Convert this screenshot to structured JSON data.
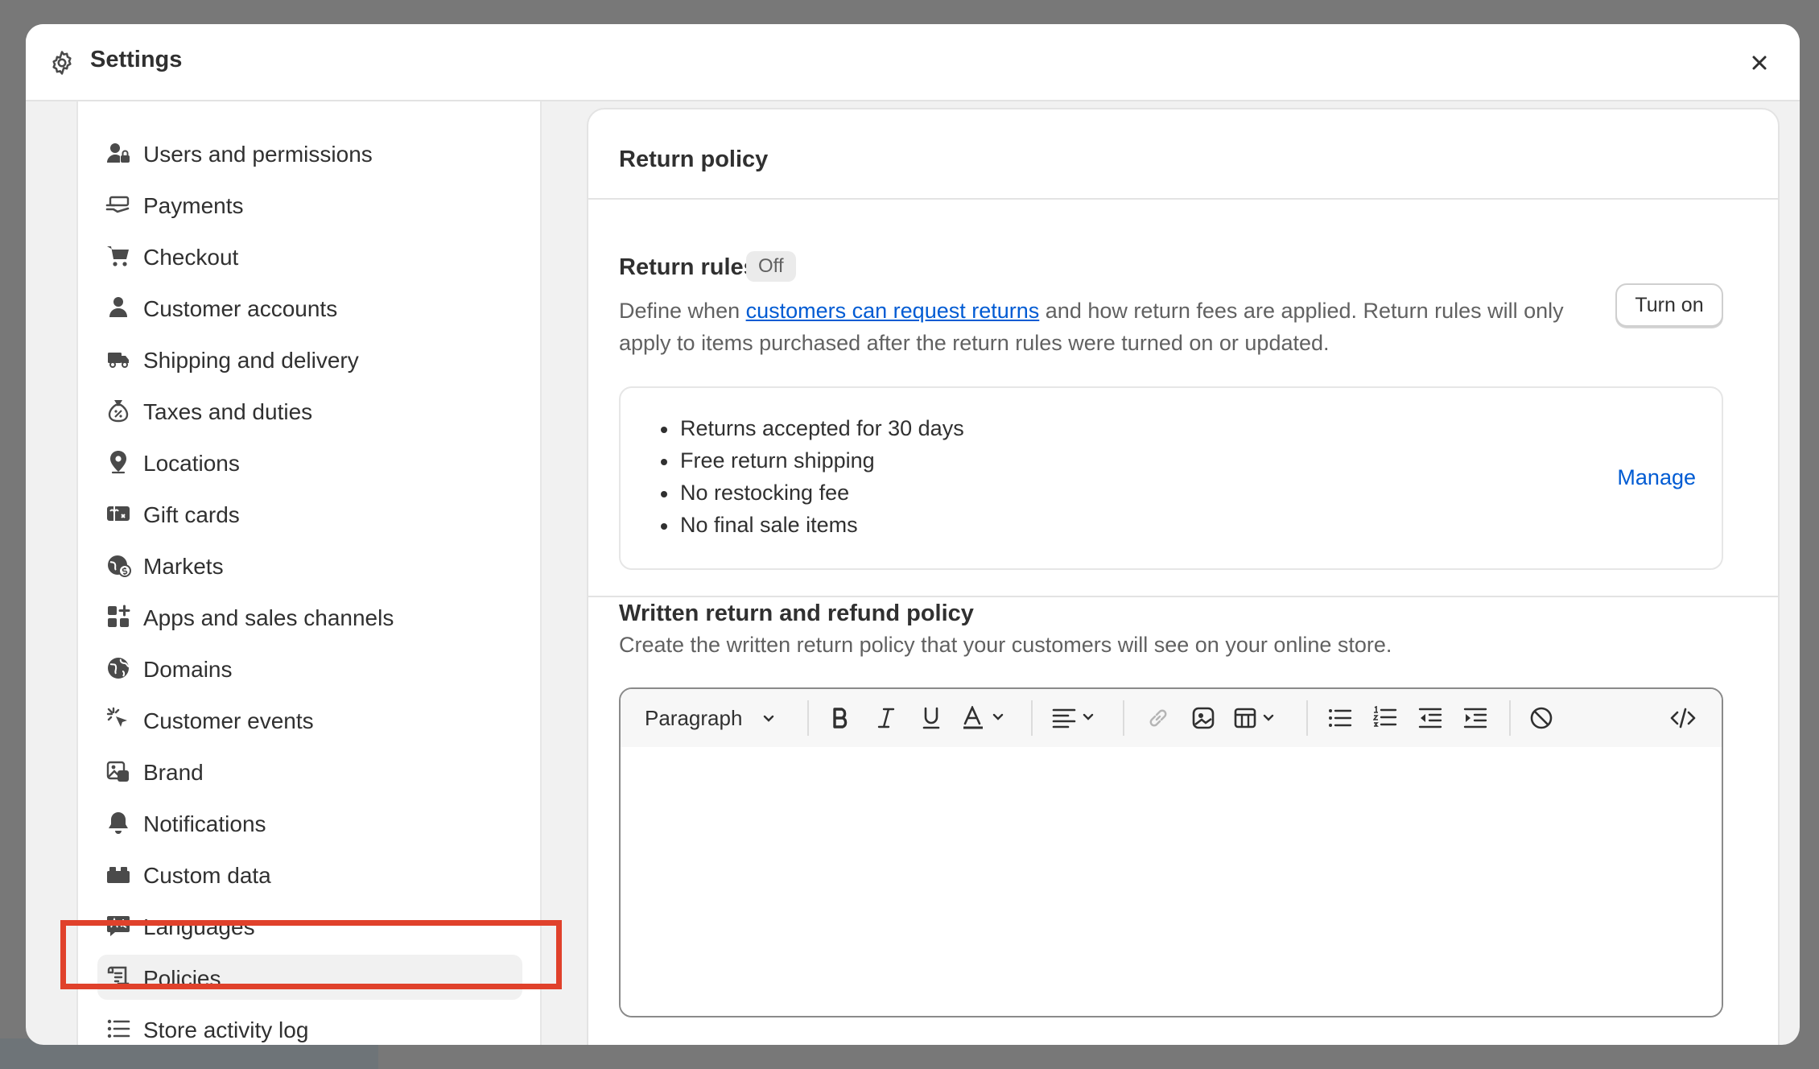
{
  "modal": {
    "title": "Settings"
  },
  "sidebar": {
    "items": [
      {
        "label": "Users and permissions",
        "icon": "user-lock-icon"
      },
      {
        "label": "Payments",
        "icon": "hand-money-icon"
      },
      {
        "label": "Checkout",
        "icon": "cart-icon"
      },
      {
        "label": "Customer accounts",
        "icon": "person-icon"
      },
      {
        "label": "Shipping and delivery",
        "icon": "truck-icon"
      },
      {
        "label": "Taxes and duties",
        "icon": "money-bag-icon"
      },
      {
        "label": "Locations",
        "icon": "map-pin-icon"
      },
      {
        "label": "Gift cards",
        "icon": "gift-card-icon"
      },
      {
        "label": "Markets",
        "icon": "globe-dollar-icon"
      },
      {
        "label": "Apps and sales channels",
        "icon": "apps-icon"
      },
      {
        "label": "Domains",
        "icon": "globe-icon"
      },
      {
        "label": "Customer events",
        "icon": "cursor-click-icon"
      },
      {
        "label": "Brand",
        "icon": "brand-image-icon"
      },
      {
        "label": "Notifications",
        "icon": "bell-icon"
      },
      {
        "label": "Custom data",
        "icon": "blocks-icon"
      },
      {
        "label": "Languages",
        "icon": "translate-icon"
      },
      {
        "label": "Policies",
        "icon": "scroll-icon",
        "active": true
      },
      {
        "label": "Store activity log",
        "icon": "list-icon"
      }
    ]
  },
  "return_policy": {
    "title": "Return policy",
    "rules_title": "Return rules",
    "rules_status": "Off",
    "desc_before": "Define when ",
    "desc_link": "customers can request returns",
    "desc_after": " and how return fees are applied. Return rules will only apply to items purchased after the return rules were turned on or updated.",
    "turn_on_label": "Turn on",
    "rules": [
      "Returns accepted for 30 days",
      "Free return shipping",
      "No restocking fee",
      "No final sale items"
    ],
    "manage_label": "Manage"
  },
  "written_policy": {
    "title": "Written return and refund policy",
    "description": "Create the written return policy that your customers will see on your online store.",
    "editor": {
      "paragraph_select": "Paragraph",
      "tools": [
        "bold-icon",
        "italic-icon",
        "underline-icon",
        "text-color-icon",
        "align-icon",
        "link-icon",
        "image-icon",
        "table-icon",
        "bullet-list-icon",
        "numbered-list-icon",
        "outdent-icon",
        "indent-icon",
        "clear-format-icon",
        "code-icon"
      ]
    }
  },
  "colors": {
    "accent_link": "#005bd3",
    "highlight": "#e0412b",
    "text": "#303030",
    "subdued_text": "#616161"
  }
}
